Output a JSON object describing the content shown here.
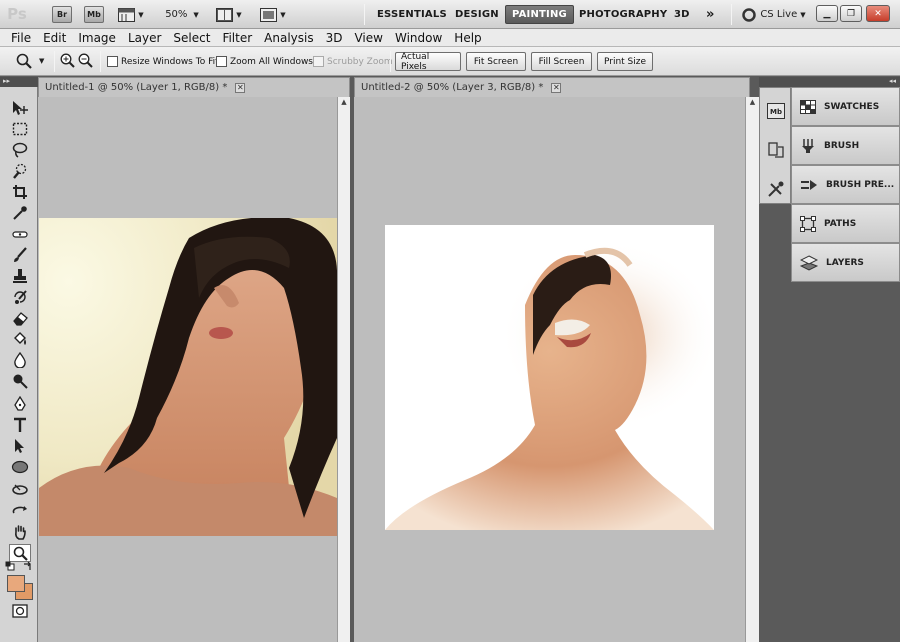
{
  "appbar": {
    "logo": "Ps",
    "bridge": "Br",
    "mini_bridge": "Mb",
    "zoom": "50%",
    "workspaces": [
      "ESSENTIALS",
      "DESIGN",
      "PAINTING",
      "PHOTOGRAPHY",
      "3D"
    ],
    "active_workspace": "PAINTING",
    "more": "»",
    "cs_live": "CS Live"
  },
  "menubar": [
    "File",
    "Edit",
    "Image",
    "Layer",
    "Select",
    "Filter",
    "Analysis",
    "3D",
    "View",
    "Window",
    "Help"
  ],
  "options": {
    "resize_windows": "Resize Windows To Fit",
    "zoom_all": "Zoom All Windows",
    "scrubby_zoom": "Scrubby Zoom",
    "actual_pixels": "Actual Pixels",
    "fit_screen": "Fit Screen",
    "fill_screen": "Fill Screen",
    "print_size": "Print Size"
  },
  "documents": [
    {
      "title": "Untitled-1 @ 50% (Layer 1, RGB/8) *"
    },
    {
      "title": "Untitled-2 @ 50% (Layer 3, RGB/8) *"
    }
  ],
  "panels": [
    "SWATCHES",
    "BRUSH",
    "BRUSH PRE...",
    "PATHS",
    "LAYERS"
  ],
  "colors": {
    "foreground": "#e8a87c",
    "background": "#e19a66",
    "active_workspace_bg": "#666666"
  }
}
